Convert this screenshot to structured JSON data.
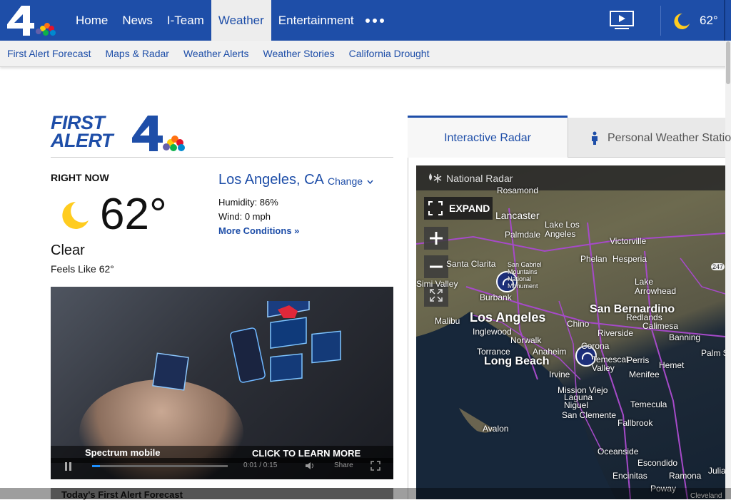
{
  "nav": {
    "items": [
      {
        "label": "Home"
      },
      {
        "label": "News"
      },
      {
        "label": "I-Team"
      },
      {
        "label": "Weather",
        "active": true
      },
      {
        "label": "Entertainment"
      }
    ],
    "current_temp": "62°"
  },
  "subnav": {
    "items": [
      "First Alert Forecast",
      "Maps & Radar",
      "Weather Alerts",
      "Weather Stories",
      "California Drought"
    ]
  },
  "first_alert": {
    "line1": "FIRST",
    "line2": "ALERT"
  },
  "current": {
    "heading": "RIGHT NOW",
    "temperature": "62°",
    "condition": "Clear",
    "feels_like": "Feels Like 62°",
    "location": "Los Angeles, CA",
    "change_label": "Change",
    "humidity": "Humidity: 86%",
    "wind": "Wind: 0 mph",
    "more_conditions": "More Conditions »"
  },
  "video": {
    "ad_brand": "Spectrum mobile",
    "ad_cta": "CLICK TO LEARN MORE",
    "time": "0:01 / 0:15",
    "share_label": "Share",
    "progress": 0.06
  },
  "forecast_heading": "Today's First Alert Forecast",
  "radar": {
    "tabs": [
      {
        "label": "Interactive Radar"
      },
      {
        "label": "Personal Weather Station"
      }
    ],
    "map_title": "National Radar",
    "expand_label": "EXPAND",
    "labels": [
      "Rosamond",
      "Lancaster",
      "Lake Los Angeles",
      "Palmdale",
      "Victorville",
      "Phelan",
      "Hesperia",
      "San Gabriel Mountains National Monument",
      "Santa Clarita",
      "Simi Valley",
      "Burbank",
      "Lake Arrowhead",
      "San Bernardino",
      "Redlands",
      "Calimesa",
      "Los Angeles",
      "Malibu",
      "Inglewood",
      "Norwalk",
      "Chino",
      "Riverside",
      "Banning",
      "Torrance",
      "Anaheim",
      "Corona",
      "Long Beach",
      "Temescal Valley",
      "Perris",
      "Hemet",
      "Palm Springs",
      "Irvine",
      "Menifee",
      "Mission Viejo",
      "Laguna Niguel",
      "San Clemente",
      "Temecula",
      "Avalon",
      "Fallbrook",
      "Oceanside",
      "Escondido",
      "Encinitas",
      "Ramona",
      "Poway",
      "Julian",
      "Cleveland",
      "247"
    ]
  },
  "colors": {
    "brand": "#1e4ea8",
    "nav_active_bg": "#ededed",
    "moon": "#ffcc1f"
  }
}
